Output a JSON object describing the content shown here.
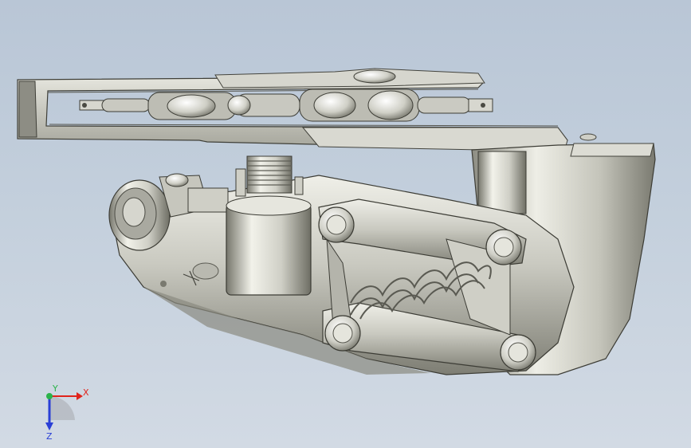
{
  "app": {
    "view": "cad-3d-viewport"
  },
  "triad": {
    "x_label": "X",
    "y_label": "Y",
    "z_label": "Z",
    "colors": {
      "x": "#e0241c",
      "y": "#2bb34a",
      "z": "#2a3fd6"
    }
  },
  "model": {
    "body_color": "#c8c8bf",
    "shadow_color": "#6f6f66",
    "highlight_color": "#f4f4ee",
    "spring_color": "#bdbdb6"
  }
}
